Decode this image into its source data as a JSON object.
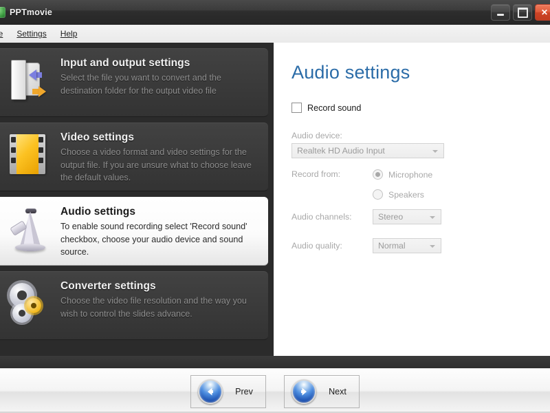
{
  "window": {
    "title": "PPTmovie",
    "icon": "app-icon",
    "controls": [
      {
        "name": "minimize",
        "glyph": "minimize-icon"
      },
      {
        "name": "maximize",
        "glyph": "maximize-icon"
      },
      {
        "name": "close",
        "glyph": "close-icon",
        "color": "#cf4426"
      }
    ]
  },
  "menubar": {
    "items": [
      {
        "label": "le",
        "full": "File",
        "accel": "F"
      },
      {
        "label": "Settings",
        "accel": "S"
      },
      {
        "label": "Help",
        "accel": "H"
      }
    ]
  },
  "sidebar": {
    "items": [
      {
        "id": "input-output-settings",
        "icon": "folder-icon",
        "title": "Input and output settings",
        "desc": "Select the file you want to convert and the destination folder for the output video file",
        "selected": false
      },
      {
        "id": "video-settings",
        "icon": "film-icon",
        "title": "Video settings",
        "desc": "Choose a video format and video settings for the output file. If you are unsure what to choose leave the default values.",
        "selected": false
      },
      {
        "id": "audio-settings",
        "icon": "megaphone-icon",
        "title": "Audio settings",
        "desc": "To enable sound recording select 'Record sound' checkbox, choose your audio device and sound source.",
        "selected": true
      },
      {
        "id": "converter-settings",
        "icon": "gears-icon",
        "title": "Converter settings",
        "desc": "Choose the video file resolution and the way you wish to control the slides advance.",
        "selected": false
      }
    ]
  },
  "panel": {
    "title": "Audio settings",
    "title_color": "#2b6ca8",
    "record_sound": {
      "label": "Record sound",
      "checked": false
    },
    "audio_device": {
      "label": "Audio device:",
      "value": "Realtek HD Audio Input",
      "enabled": false
    },
    "record_from": {
      "label": "Record from:",
      "options": [
        {
          "label": "Microphone",
          "selected": true
        },
        {
          "label": "Speakers",
          "selected": false
        }
      ],
      "enabled": false
    },
    "audio_channels": {
      "label": "Audio channels:",
      "value": "Stereo",
      "enabled": false
    },
    "audio_quality": {
      "label": "Audio quality:",
      "value": "Normal",
      "enabled": false
    }
  },
  "footer": {
    "prev": {
      "label": "Prev",
      "icon": "arrow-left-circle-icon"
    },
    "next": {
      "label": "Next",
      "icon": "arrow-right-circle-icon"
    }
  }
}
